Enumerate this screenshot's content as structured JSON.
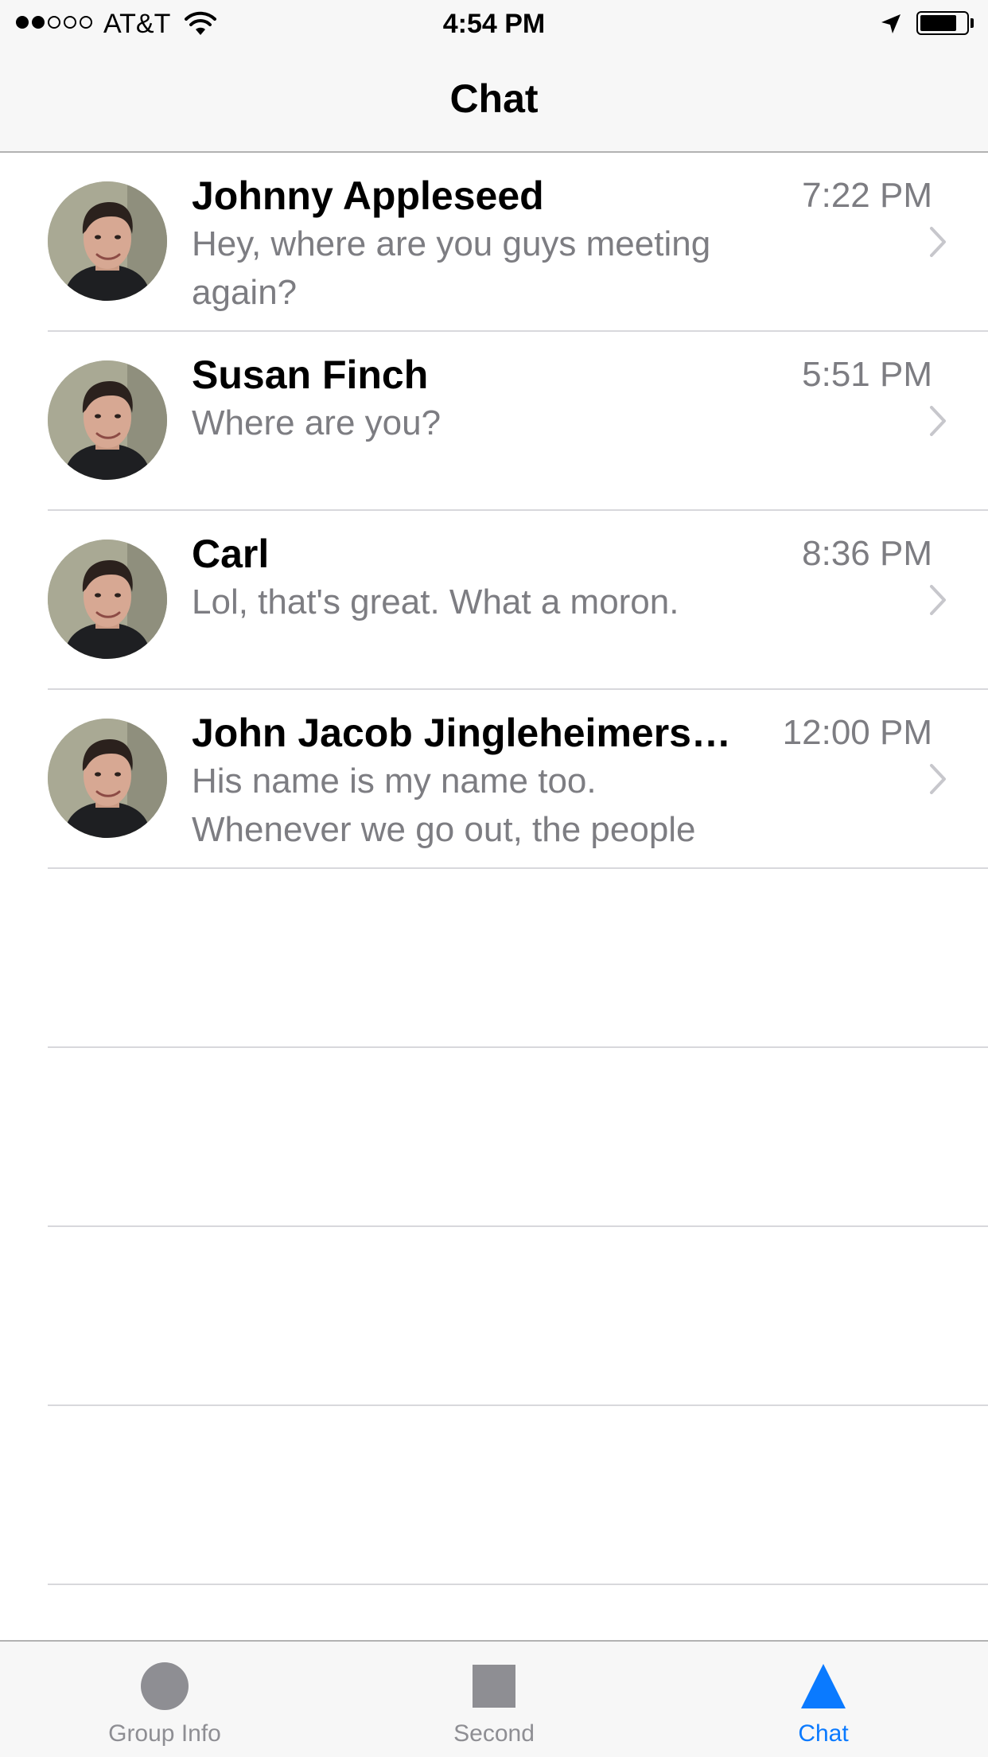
{
  "status_bar": {
    "carrier": "AT&T",
    "time": "4:54 PM",
    "signal_bars_filled": 2,
    "signal_bars_total": 5,
    "battery_level": 0.8
  },
  "nav": {
    "title": "Chat"
  },
  "conversations": [
    {
      "name": "Johnny Appleseed",
      "time": "7:22 PM",
      "preview": "Hey, where are you guys meeting again?"
    },
    {
      "name": "Susan Finch",
      "time": "5:51 PM",
      "preview": "Where are you?"
    },
    {
      "name": "Carl",
      "time": "8:36 PM",
      "preview": "Lol, that's great. What a moron."
    },
    {
      "name": "John Jacob Jingleheimerschmidt",
      "time": "12:00 PM",
      "preview": "His name is my name too. Whenever we go out, the people always shout, \"there goes John Jacob Jingleheimerschmidt\""
    }
  ],
  "tabs": [
    {
      "label": "Group Info",
      "icon": "circle-icon",
      "active": false
    },
    {
      "label": "Second",
      "icon": "square-icon",
      "active": false
    },
    {
      "label": "Chat",
      "icon": "triangle-icon",
      "active": true
    }
  ],
  "colors": {
    "accent": "#0a7aff",
    "inactive": "#8e8e93",
    "secondary_text": "#7d7d82",
    "separator": "#d8d8dc",
    "bar_background": "#f7f7f7"
  }
}
